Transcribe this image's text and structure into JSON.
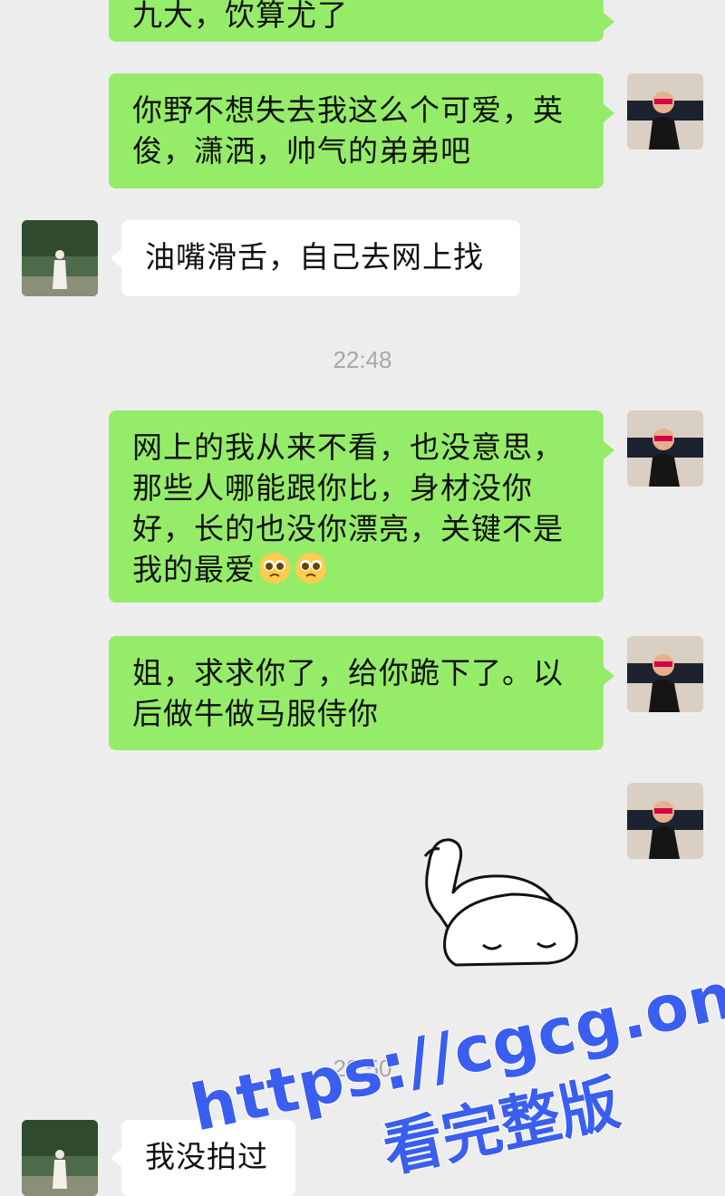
{
  "messages": [
    {
      "text": "九大，饮算尤了"
    },
    {
      "text": "你野不想失去我这么个可爱，英俊，潇洒，帅气的弟弟吧"
    },
    {
      "text": "油嘴滑舌，自己去网上找"
    },
    {
      "text": "网上的我从来不看，也没意思，那些人哪能跟你比，身材没你好，长的也没你漂亮，关键不是我的最爱"
    },
    {
      "text": "姐，求求你了，给你跪下了。以后做牛做马服侍你"
    },
    {
      "text": "我没拍过"
    }
  ],
  "timestamps": [
    "22:48",
    "22:50"
  ],
  "watermark": {
    "url": "https://cgcg.one",
    "caption": "看完整版"
  },
  "colors": {
    "background": "#ededed",
    "sent_bubble": "#95ec69",
    "recv_bubble": "#ffffff",
    "timestamp": "#a8a8a8",
    "watermark": "#3a5ef0"
  },
  "icons": {
    "pleading_emoji": "pleading-face-emoji",
    "sticker": "swan-blob-sticker"
  }
}
